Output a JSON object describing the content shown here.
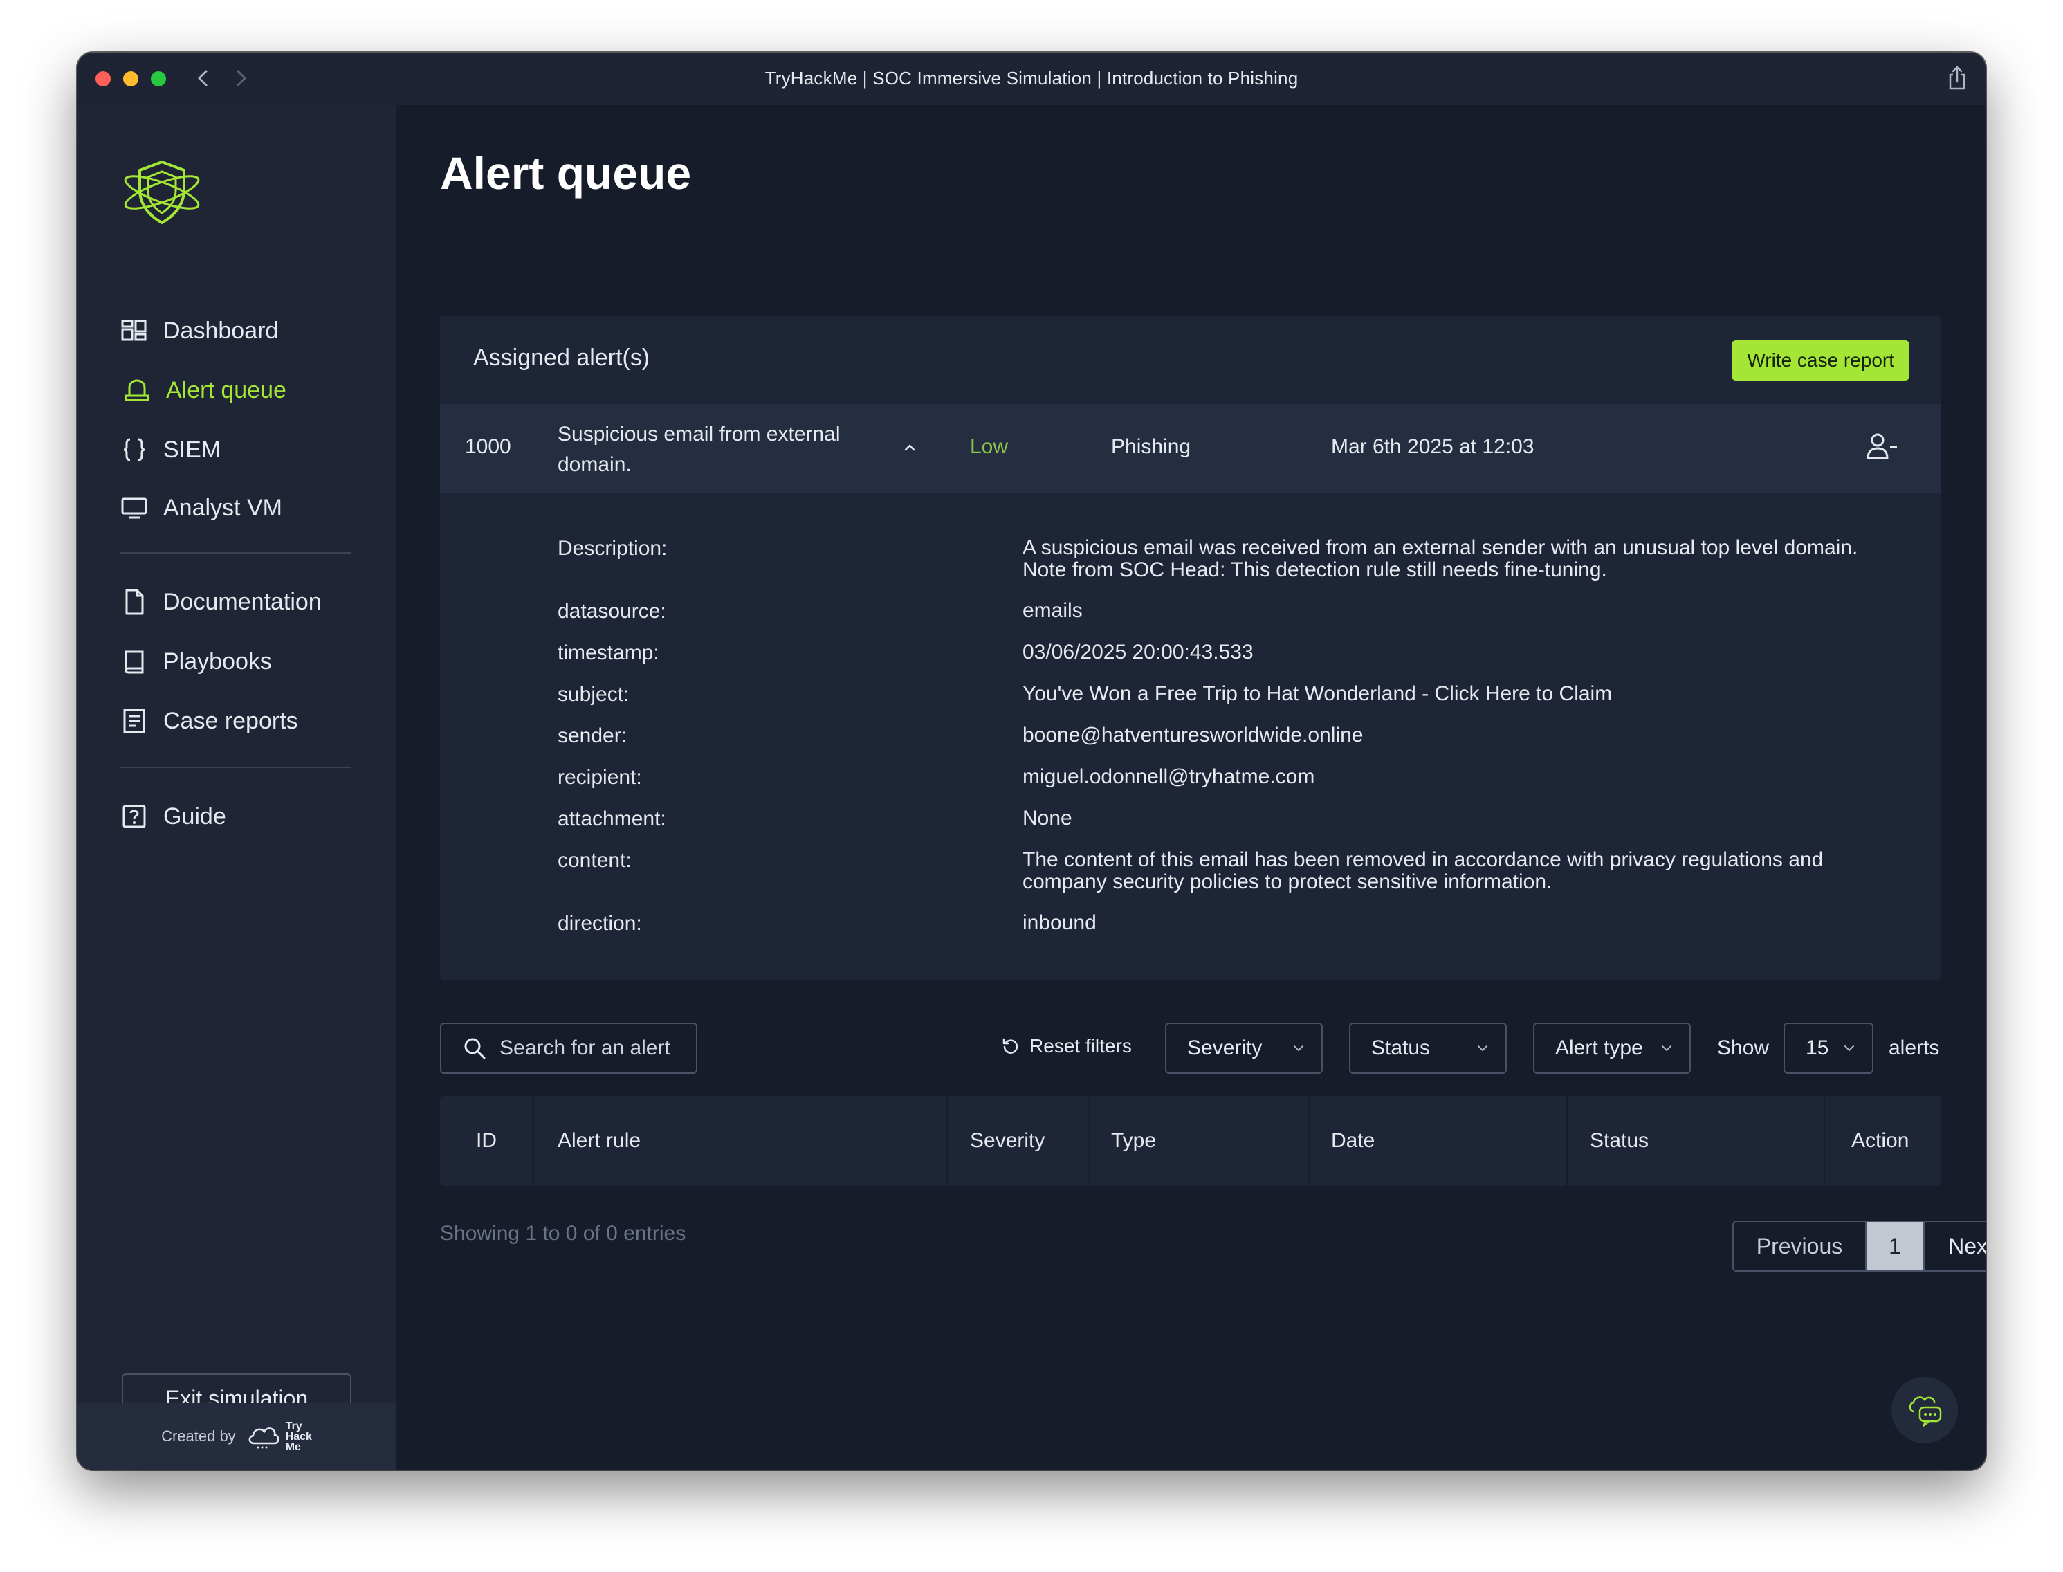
{
  "window": {
    "title": "TryHackMe | SOC Immersive Simulation | Introduction to Phishing"
  },
  "sidebar": {
    "items": [
      {
        "label": "Dashboard",
        "icon": "dashboard-icon"
      },
      {
        "label": "Alert queue",
        "icon": "alert-queue-icon",
        "active": true
      },
      {
        "label": "SIEM",
        "icon": "braces-icon"
      },
      {
        "label": "Analyst VM",
        "icon": "monitor-icon"
      },
      {
        "label": "Documentation",
        "icon": "document-icon"
      },
      {
        "label": "Playbooks",
        "icon": "book-icon"
      },
      {
        "label": "Case reports",
        "icon": "report-icon"
      },
      {
        "label": "Guide",
        "icon": "question-icon"
      }
    ],
    "exit_label": "Exit simulation",
    "created_by": "Created by",
    "brand_logo_text": "Try Hack Me"
  },
  "main": {
    "title": "Alert queue",
    "assigned": {
      "heading": "Assigned alert(s)",
      "write_report_label": "Write case report",
      "alert": {
        "id": "1000",
        "rule": "Suspicious email from external domain.",
        "severity": "Low",
        "type": "Phishing",
        "date": "Mar 6th 2025 at 12:03"
      },
      "details": [
        {
          "key": "Description:",
          "value": "A suspicious email was received from an external sender with an unusual top level domain. Note from SOC Head: This detection rule still needs fine-tuning."
        },
        {
          "key": "datasource:",
          "value": "emails"
        },
        {
          "key": "timestamp:",
          "value": "03/06/2025 20:00:43.533"
        },
        {
          "key": "subject:",
          "value": "You've Won a Free Trip to Hat Wonderland - Click Here to Claim"
        },
        {
          "key": "sender:",
          "value": "boone@hatventuresworldwide.online"
        },
        {
          "key": "recipient:",
          "value": "miguel.odonnell@tryhatme.com"
        },
        {
          "key": "attachment:",
          "value": "None"
        },
        {
          "key": "content:",
          "value": "The content of this email has been removed in accordance with privacy regulations and company security policies to protect sensitive information."
        },
        {
          "key": "direction:",
          "value": "inbound"
        }
      ]
    },
    "filters": {
      "search_placeholder": "Search for an alert",
      "reset_label": "Reset filters",
      "severity_label": "Severity",
      "status_label": "Status",
      "alert_type_label": "Alert type",
      "show_label": "Show",
      "show_value": "15",
      "alerts_label": "alerts"
    },
    "table": {
      "columns": [
        "ID",
        "Alert rule",
        "Severity",
        "Type",
        "Date",
        "Status",
        "Action"
      ]
    },
    "showing_text": "Showing 1 to 0 of 0 entries",
    "pagination": {
      "previous": "Previous",
      "current": "1",
      "next": "Next"
    }
  },
  "colors": {
    "accent": "#a3e635",
    "severity_low": "#8bc34a",
    "background": "#161c2a",
    "sidebar": "#1f2535"
  }
}
